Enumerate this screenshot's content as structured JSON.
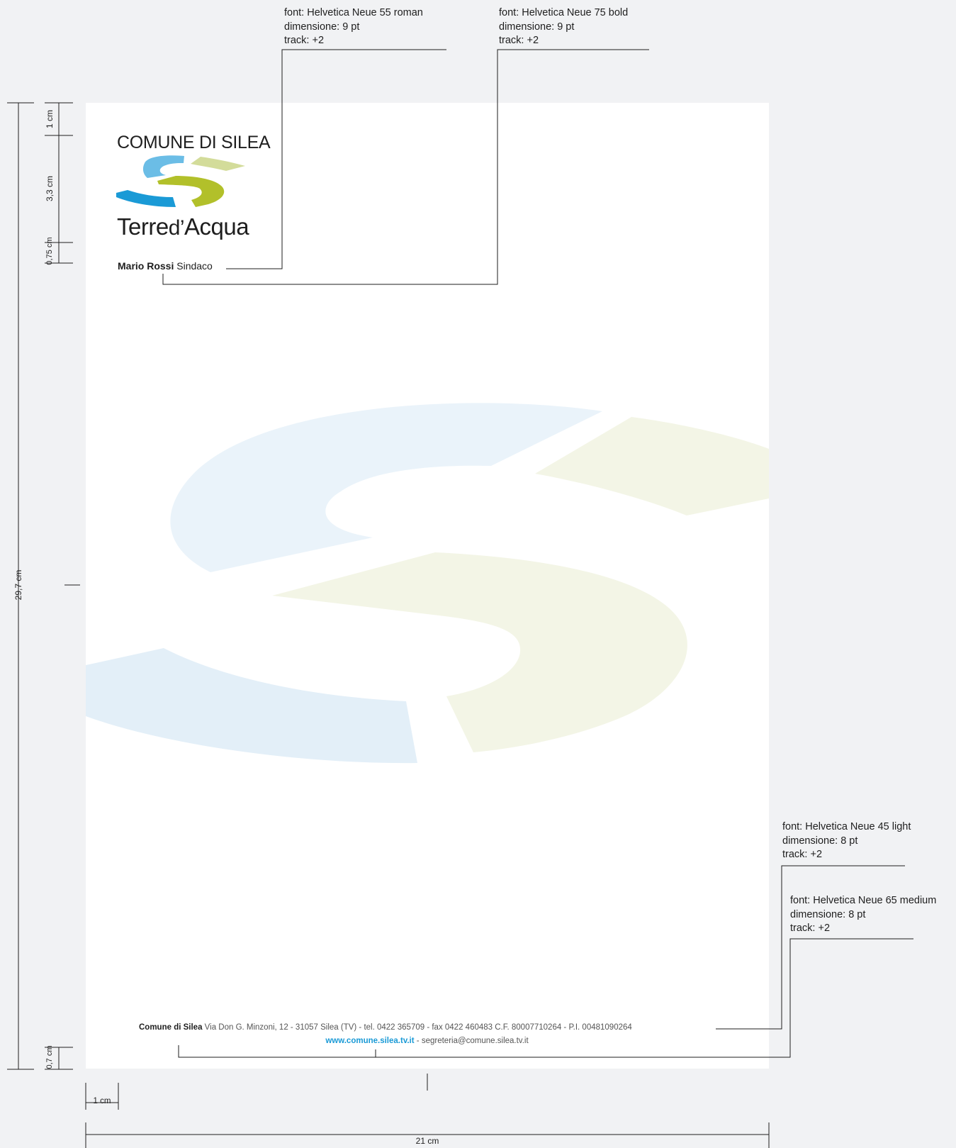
{
  "specs": {
    "roman": {
      "font": "font: Helvetica Neue 55 roman",
      "size": "dimensione: 9 pt",
      "track": "track: +2"
    },
    "bold": {
      "font": "font: Helvetica Neue 75 bold",
      "size": "dimensione: 9 pt",
      "track": "track: +2"
    },
    "light": {
      "font": "font: Helvetica Neue 45 light",
      "size": "dimensione: 8 pt",
      "track": "track: +2"
    },
    "medium": {
      "font": "font: Helvetica Neue 65 medium",
      "size": "dimensione: 8 pt",
      "track": "track: +2"
    }
  },
  "dimensions": {
    "top_margin": "1 cm",
    "logo_height": "3,3 cm",
    "logo_gap": "0,75 cm",
    "page_height": "29,7 cm",
    "bottom_margin": "0,7 cm",
    "left_margin": "1 cm",
    "page_width": "21 cm"
  },
  "logo": {
    "org_name": "COMUNE DI SILEA",
    "brand_light": "Terre",
    "brand_mid": "d’",
    "brand_bold": "Acqua",
    "colors": {
      "blue_light": "#6bbde6",
      "blue_dark": "#1a9ad6",
      "green_light": "#d3dc9a",
      "green_dark": "#b2c02a"
    }
  },
  "signer": {
    "name": "Mario Rossi",
    "role": "Sindaco"
  },
  "footer": {
    "org": "Comune di Silea",
    "address": "Via Don G. Minzoni, 12 - 31057 Silea (TV) - tel. 0422 365709 - fax 0422 460483 C.F. 80007710264 - P.I. 00481090264",
    "website": "www.comune.silea.tv.it",
    "separator": "-",
    "email": "segreteria@comune.silea.tv.it"
  },
  "watermark_colors": {
    "blue": "#e3eff8",
    "green": "#f3f5e6"
  }
}
